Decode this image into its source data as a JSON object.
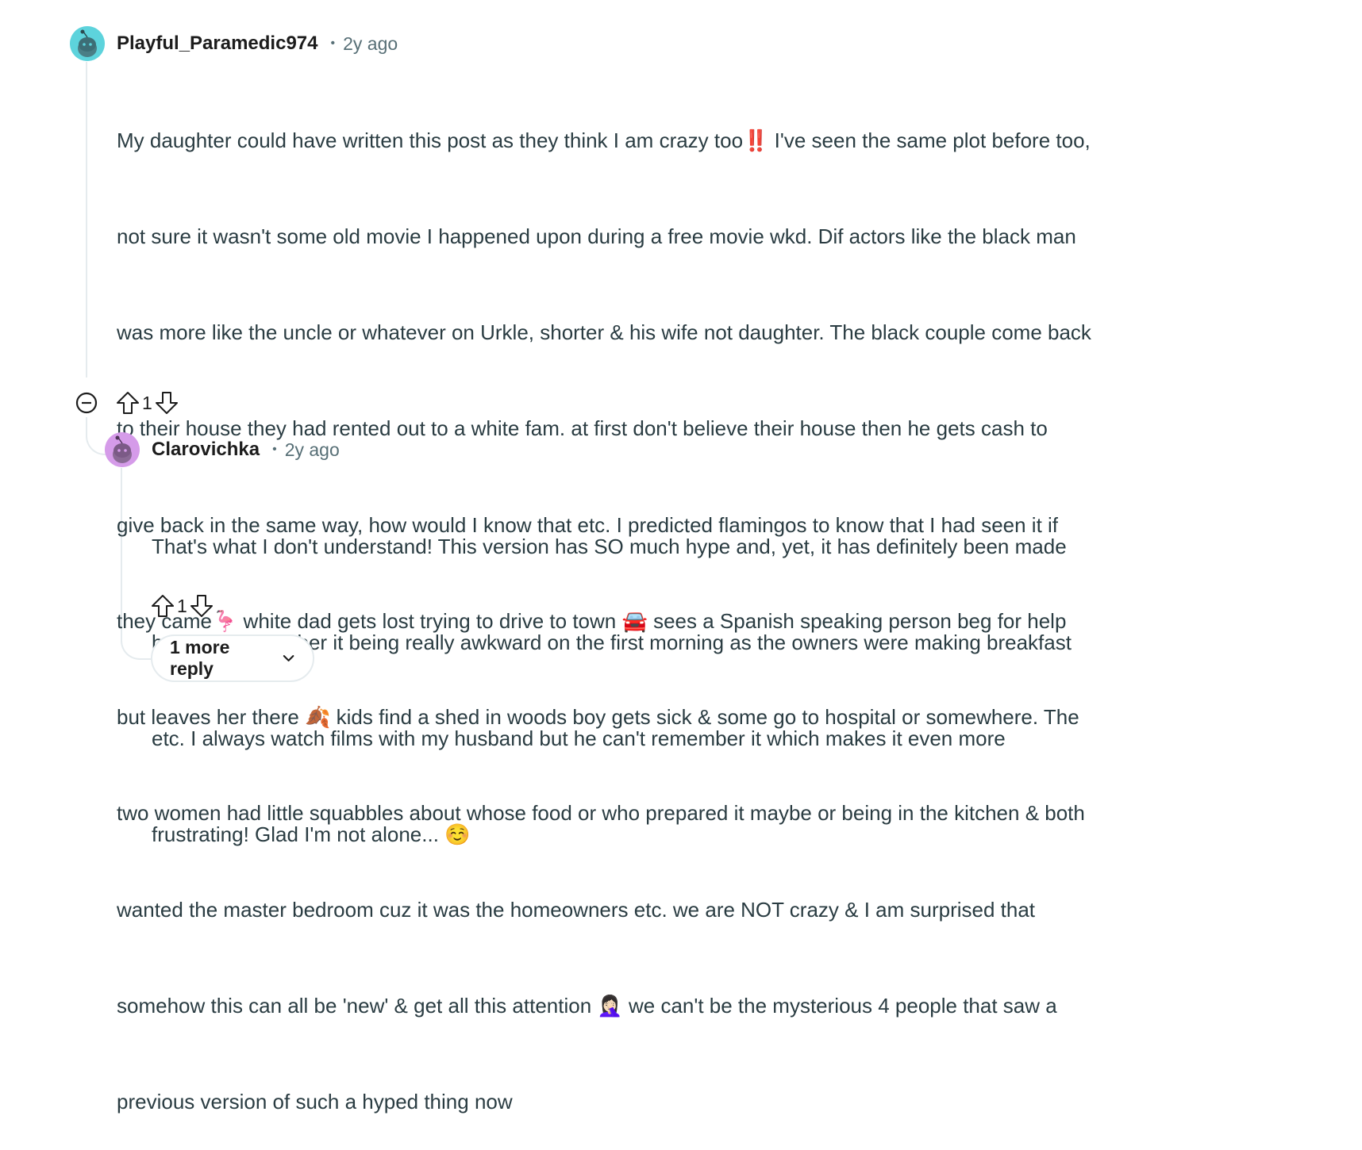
{
  "comments": [
    {
      "username": "Playful_Paramedic974",
      "dot": "•",
      "time": "2y ago",
      "avatar_color": "#5dd3dc",
      "lines": [
        "My daughter could have written this post as they think I am crazy too",
        "‼️",
        " I've seen the same plot before too,",
        "not sure it wasn't some old movie I happened upon during a free movie wkd. Dif actors like the black man",
        "was more like the uncle or whatever on Urkle, shorter & his wife not daughter. The black couple come back",
        "to their house they had rented out to a white fam. at first don't believe their house then he gets cash to",
        "give back in the same way, how would I know that etc. I predicted flamingos to know that I had seen it if",
        "they came",
        "🦩",
        " white dad gets lost trying to drive to town ",
        "🚘",
        " sees a Spanish speaking person beg for help",
        "but leaves her there ",
        "🍂",
        " kids find a shed in woods boy gets sick & some go to hospital or somewhere. The",
        "two women had little squabbles about whose food or who prepared it maybe or being in the kitchen & both",
        "wanted the master bedroom cuz it was the homeowners etc. we are NOT crazy & I am surprised that",
        "somehow this can all be 'new' & get all this attention ",
        "🤦🏻‍♀️",
        " we can't be the mysterious 4 people that saw a",
        "previous version of such a hyped thing now"
      ],
      "votes": "1"
    },
    {
      "username": "Clarovichka",
      "dot": "•",
      "time": "2y ago",
      "avatar_color": "#d59be9",
      "lines": [
        "That's what I don't understand! This version has SO much hype and, yet, it has definitely been made",
        "before. I remember it being really awkward on the first morning as the owners were making breakfast",
        "etc. I always watch films with my husband but he can't remember it which makes it even more",
        "frustrating! Glad I'm not alone... ",
        "☺️"
      ],
      "votes": "1"
    }
  ],
  "more_replies": {
    "label": "1 more reply"
  },
  "icons": {
    "collapse": "collapse-minus-icon",
    "upvote": "upvote-arrow-icon",
    "downvote": "downvote-arrow-icon",
    "chevron": "chevron-down-icon",
    "avatar": "snoo-avatar-icon"
  }
}
